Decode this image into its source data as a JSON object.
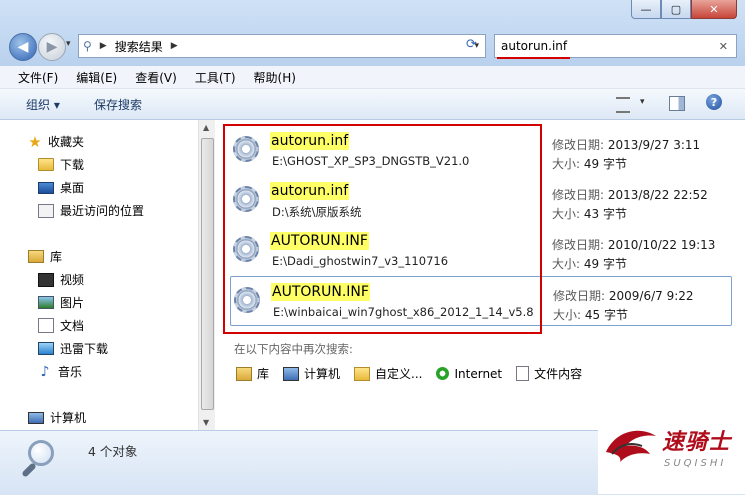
{
  "window": {
    "min_glyph": "—",
    "max_glyph": "▢",
    "close_glyph": "✕"
  },
  "address": {
    "crumb": "搜索结果",
    "back_glyph": "◀",
    "forward_glyph": "▶",
    "refresh_glyph": "⟳"
  },
  "search": {
    "value": "autorun.inf",
    "clear_glyph": "✕"
  },
  "menu": [
    "文件(F)",
    "编辑(E)",
    "查看(V)",
    "工具(T)",
    "帮助(H)"
  ],
  "toolbar": {
    "organize": "组织 ▾",
    "save_search": "保存搜索",
    "help_glyph": "?"
  },
  "nav": {
    "favorites": "收藏夹",
    "downloads": "下载",
    "desktop": "桌面",
    "recent": "最近访问的位置",
    "libraries": "库",
    "videos": "视频",
    "pictures": "图片",
    "documents": "文档",
    "thunder": "迅雷下载",
    "music": "音乐",
    "computer": "计算机"
  },
  "results": [
    {
      "name": "autorun.inf",
      "path": "E:\\GHOST_XP_SP3_DNGSTB_V21.0",
      "modified_label": "修改日期:",
      "modified": "2013/9/27 3:11",
      "size_label": "大小:",
      "size": "49 字节"
    },
    {
      "name": "autorun.inf",
      "path": "D:\\系统\\原版系统",
      "modified_label": "修改日期:",
      "modified": "2013/8/22 22:52",
      "size_label": "大小:",
      "size": "43 字节"
    },
    {
      "name": "AUTORUN.INF",
      "path": "E:\\Dadi_ghostwin7_v3_110716",
      "modified_label": "修改日期:",
      "modified": "2010/10/22 19:13",
      "size_label": "大小:",
      "size": "49 字节"
    },
    {
      "name": "AUTORUN.INF",
      "path": "E:\\winbaicai_win7ghost_x86_2012_1_14_v5.8",
      "modified_label": "修改日期:",
      "modified": "2009/6/7 9:22",
      "size_label": "大小:",
      "size": "45 字节"
    }
  ],
  "search_again": {
    "label": "在以下内容中再次搜索:",
    "items": [
      "库",
      "计算机",
      "自定义...",
      "Internet",
      "文件内容"
    ]
  },
  "status": {
    "count": "4 个对象"
  },
  "watermark": {
    "cn": "速骑士",
    "en": "SUQISHI"
  },
  "colors": {
    "highlight": "#ffff66",
    "annotation_red": "#d40000",
    "accent": "#1c3a66"
  }
}
